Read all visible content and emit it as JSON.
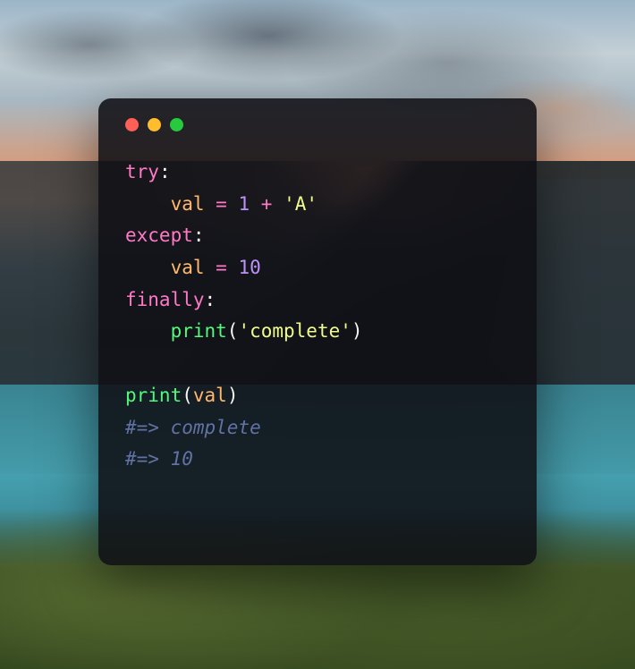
{
  "code": {
    "line1_try": "try",
    "line1_colon": ":",
    "line2_indent": "    ",
    "line2_var": "val",
    "line2_space1": " ",
    "line2_eq": "=",
    "line2_space2": " ",
    "line2_num": "1",
    "line2_space3": " ",
    "line2_plus": "+",
    "line2_space4": " ",
    "line2_str": "'A'",
    "line3_except": "except",
    "line3_colon": ":",
    "line4_indent": "    ",
    "line4_var": "val",
    "line4_space1": " ",
    "line4_eq": "=",
    "line4_space2": " ",
    "line4_num": "10",
    "line5_finally": "finally",
    "line5_colon": ":",
    "line6_indent": "    ",
    "line6_fn": "print",
    "line6_lparen": "(",
    "line6_str": "'complete'",
    "line6_rparen": ")",
    "line7_blank": "",
    "line8_fn": "print",
    "line8_lparen": "(",
    "line8_var": "val",
    "line8_rparen": ")",
    "line9_comment": "#=> complete",
    "line10_comment": "#=> 10"
  }
}
